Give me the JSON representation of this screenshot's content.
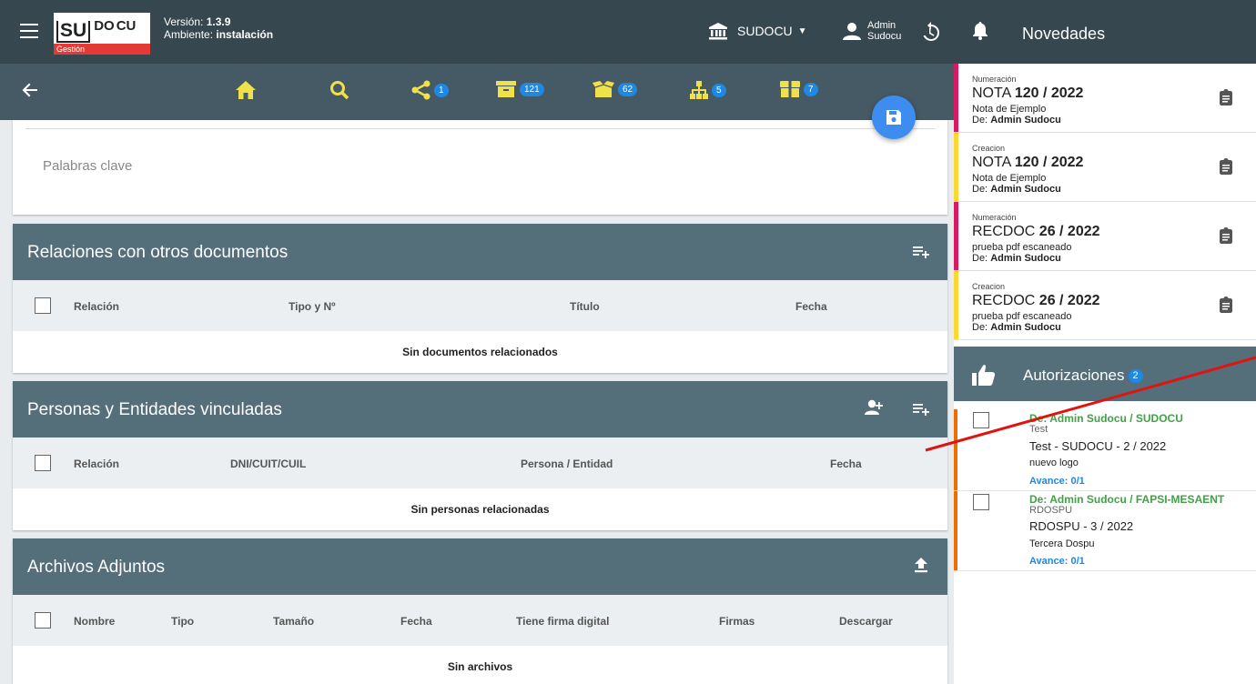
{
  "header": {
    "logo": {
      "su": "SU",
      "do": "DO",
      "cu": "CU",
      "subtitle": "Gestión"
    },
    "version_label": "Versión:",
    "version_value": "1.3.9",
    "env_label": "Ambiente:",
    "env_value": "instalación",
    "org_name": "SUDOCU",
    "user_first": "Admin",
    "user_last": "Sudocu"
  },
  "toolbar": {
    "share_count": "1",
    "archive_count": "121",
    "box_count": "62",
    "hierarchy_count": "5",
    "package_count": "7"
  },
  "keywords": {
    "label": "Palabras clave"
  },
  "relations": {
    "title": "Relaciones con otros documentos",
    "columns": [
      "Relación",
      "Tipo y Nº",
      "Título",
      "Fecha"
    ],
    "empty": "Sin documentos relacionados"
  },
  "people": {
    "title": "Personas y Entidades vinculadas",
    "columns": [
      "Relación",
      "DNI/CUIT/CUIL",
      "Persona / Entidad",
      "Fecha"
    ],
    "empty": "Sin personas relacionadas"
  },
  "attachments": {
    "title": "Archivos Adjuntos",
    "columns": [
      "Nombre",
      "Tipo",
      "Tamaño",
      "Fecha",
      "Tiene firma digital",
      "Firmas",
      "Descargar"
    ],
    "empty": "Sin archivos"
  },
  "news": {
    "title": "Novedades",
    "items": [
      {
        "type": "Numeración",
        "doc_type": "NOTA",
        "doc_num": "120 / 2022",
        "desc": "Nota de Ejemplo",
        "from_label": "De:",
        "from": "Admin Sudocu",
        "color": "#d81b60"
      },
      {
        "type": "Creacion",
        "doc_type": "NOTA",
        "doc_num": "120 / 2022",
        "desc": "Nota de Ejemplo",
        "from_label": "De:",
        "from": "Admin Sudocu",
        "color": "#fdd835"
      },
      {
        "type": "Numeración",
        "doc_type": "RECDOC",
        "doc_num": "26 / 2022",
        "desc": "prueba pdf escaneado",
        "from_label": "De:",
        "from": "Admin Sudocu",
        "color": "#d81b60"
      },
      {
        "type": "Creacion",
        "doc_type": "RECDOC",
        "doc_num": "26 / 2022",
        "desc": "prueba pdf escaneado",
        "from_label": "De:",
        "from": "Admin Sudocu",
        "color": "#fdd835"
      }
    ]
  },
  "authorizations": {
    "title": "Autorizaciones",
    "count": "2",
    "items": [
      {
        "from": "De: Admin Sudocu / SUDOCU",
        "type": "Test",
        "doc": "Test - SUDOCU - 2 / 2022",
        "desc": "nuevo logo",
        "progress": "Avance: 0/1"
      },
      {
        "from": "De: Admin Sudocu / FAPSI-MESAENT",
        "type": "RDOSPU",
        "doc": "RDOSPU - 3 / 2022",
        "desc": "Tercera Dospu",
        "progress": "Avance: 0/1"
      }
    ]
  }
}
